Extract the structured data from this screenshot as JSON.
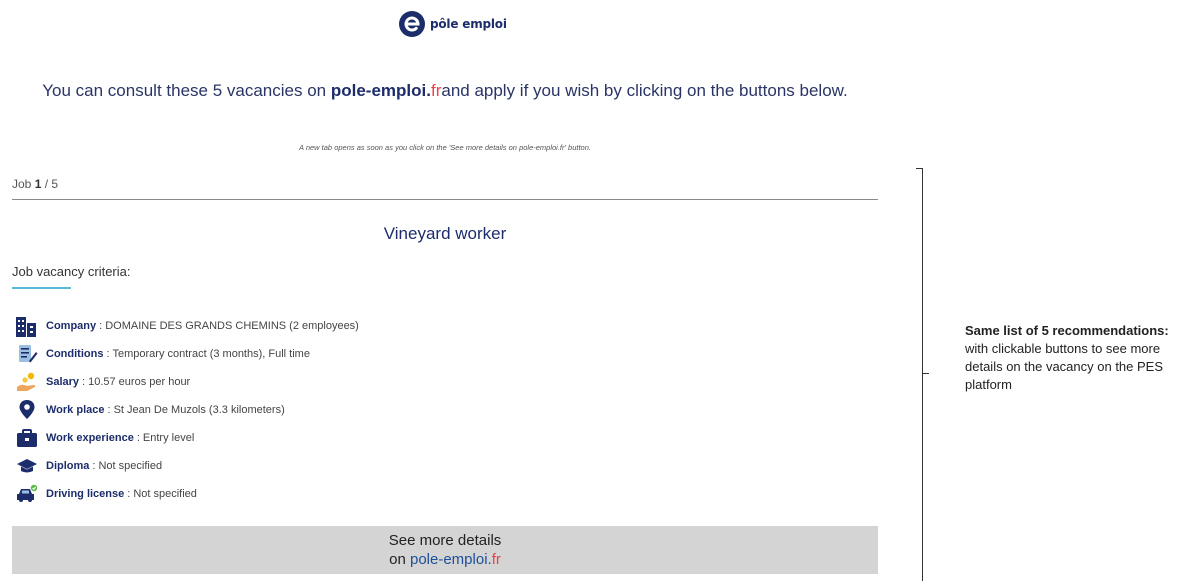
{
  "logo": {
    "text": "pôle emploi",
    "icon": "pole-emploi-logo-icon",
    "color": "#1d2d6b"
  },
  "headline": {
    "before": "You can consult these 5 vacancies on ",
    "brand": "pole-emploi.",
    "brand_fr": "fr",
    "after": "and apply if you wish by clicking on the buttons below."
  },
  "tab_note": "A new tab opens as soon as you click on the 'See more details on pole-emploi.fr' button.",
  "job_counter": {
    "label": "Job ",
    "current": "1",
    "sep": " / ",
    "total": "5"
  },
  "job_title": "Vineyard worker",
  "criteria_heading": "Job vacancy criteria:",
  "criteria": [
    {
      "icon": "company-building-icon",
      "label": "Company",
      "sep": ":",
      "value": "DOMAINE DES GRANDS CHEMINS (2 employees)"
    },
    {
      "icon": "contract-document-icon",
      "label": "Conditions",
      "sep": ":",
      "value": "Temporary contract (3 months), Full time"
    },
    {
      "icon": "salary-hand-icon",
      "label": "Salary",
      "sep": ":",
      "value": "10.57 euros per hour"
    },
    {
      "icon": "map-pin-icon",
      "label": "Work place",
      "sep": ":",
      "value": "St Jean De Muzols (3.3 kilometers)"
    },
    {
      "icon": "briefcase-icon",
      "label": "Work experience",
      "sep": ":",
      "value": "Entry level"
    },
    {
      "icon": "graduation-cap-icon",
      "label": "Diploma",
      "sep": ":",
      "value": "Not specified"
    },
    {
      "icon": "car-icon",
      "label": "Driving license",
      "sep": ":",
      "value": "Not specified"
    }
  ],
  "more_button": {
    "line1": "See more details",
    "line2_prefix": "on ",
    "site": "pole-emploi.",
    "site_fr": "fr"
  },
  "side_note": {
    "title": "Same list of 5 recommendations:",
    "body": "with clickable buttons to see more details on the vacancy on the PES platform"
  },
  "colors": {
    "brand_blue": "#1d2d6b",
    "brand_red": "#e8424f",
    "accent_cyan": "#5ab9d8",
    "button_gray": "#d4d4d4"
  }
}
